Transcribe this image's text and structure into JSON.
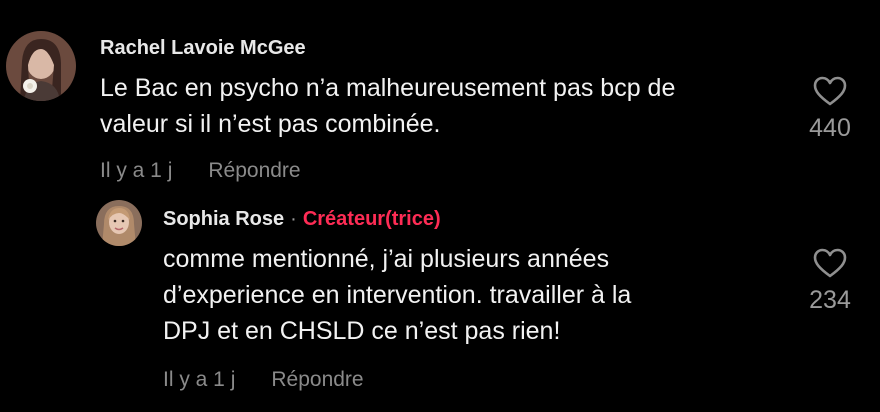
{
  "comments": [
    {
      "username": "Rachel Lavoie McGee",
      "lines": [
        "Le Bac en psycho n’a malheureusement pas bcp de",
        "valeur si il n’est pas combinée."
      ],
      "time": "Il y a 1 j",
      "reply_label": "Répondre",
      "likes": "440",
      "like_icon": "heart-outline-icon"
    }
  ],
  "replies": [
    {
      "username": "Sophia Rose",
      "separator": "·",
      "badge": "Créateur(trice)",
      "badge_color": "#fe2c55",
      "lines": [
        "comme mentionné, j’ai plusieurs années",
        "d’experience en intervention. travailler à la",
        "DPJ et en CHSLD ce n’est pas rien!"
      ],
      "time": "Il y a 1 j",
      "reply_label": "Répondre",
      "likes": "234",
      "like_icon": "heart-outline-icon"
    }
  ]
}
